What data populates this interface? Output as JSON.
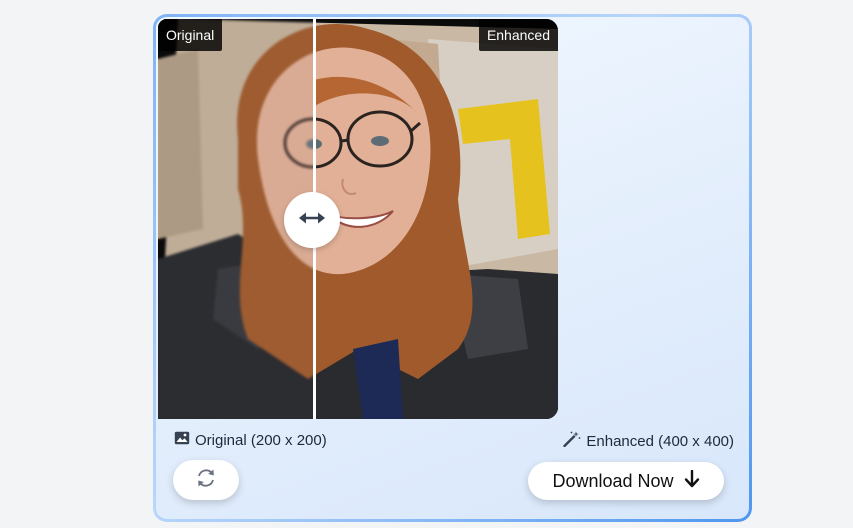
{
  "comparison": {
    "original_tag": "Original",
    "enhanced_tag": "Enhanced",
    "original_caption": "Original (200 x 200)",
    "enhanced_caption": "Enhanced (400 x 400)"
  },
  "actions": {
    "download_label": "Download Now"
  },
  "icons": {
    "handle": "left-right-arrows-icon",
    "original_caption": "image-icon",
    "enhanced_caption": "magic-wand-icon",
    "retry": "refresh-icon",
    "download": "arrow-down-icon"
  },
  "colors": {
    "card_border": "#4f96ef",
    "card_background": "#e3eefc",
    "button_background": "#ffffff",
    "tag_background": "#000000"
  }
}
